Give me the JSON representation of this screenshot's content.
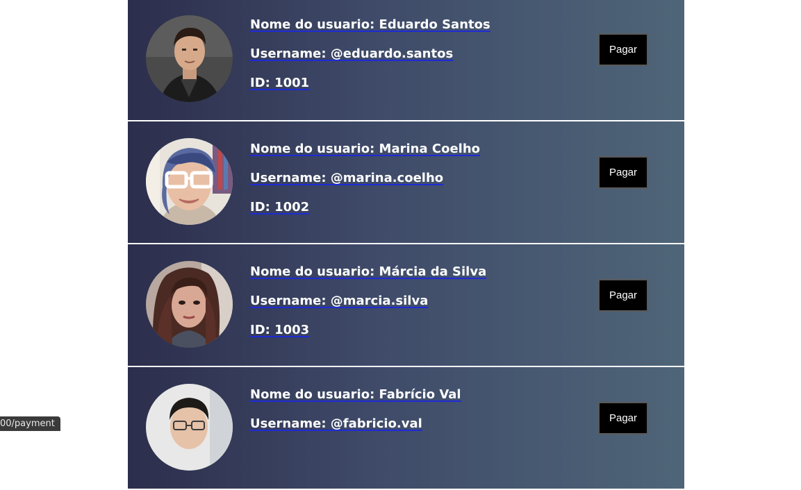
{
  "users": [
    {
      "name_line": "Nome do usuario: Eduardo Santos",
      "username_line": "Username: @eduardo.santos",
      "id_line": "ID: 1001",
      "button_label": "Pagar"
    },
    {
      "name_line": "Nome do usuario: Marina Coelho",
      "username_line": "Username: @marina.coelho",
      "id_line": "ID: 1002",
      "button_label": "Pagar"
    },
    {
      "name_line": "Nome do usuario: Márcia da Silva",
      "username_line": "Username: @marcia.silva",
      "id_line": "ID: 1003",
      "button_label": "Pagar"
    },
    {
      "name_line": "Nome do usuario: Fabrício Val",
      "username_line": "Username: @fabricio.val",
      "id_line": "",
      "button_label": "Pagar"
    }
  ],
  "status_bar": {
    "url": "00/payment"
  }
}
